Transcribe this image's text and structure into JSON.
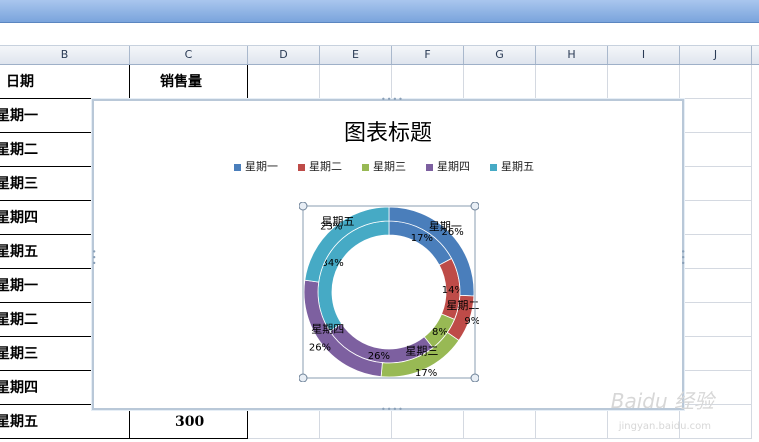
{
  "columns": [
    "B",
    "C",
    "D",
    "E",
    "F",
    "G",
    "H",
    "I",
    "J"
  ],
  "header_row": {
    "date_label": "日期",
    "sales_label": "销售量"
  },
  "rows": [
    {
      "day": "星期一"
    },
    {
      "day": "星期二"
    },
    {
      "day": "星期三"
    },
    {
      "day": "星期四"
    },
    {
      "day": "星期五"
    },
    {
      "day": "星期一"
    },
    {
      "day": "星期二"
    },
    {
      "day": "星期三"
    },
    {
      "day": "星期四"
    },
    {
      "day": "星期五",
      "sales": "300"
    }
  ],
  "chart": {
    "title": "图表标题"
  },
  "chart_data": {
    "type": "doughnut",
    "title": "图表标题",
    "categories": [
      "星期一",
      "星期二",
      "星期三",
      "星期四",
      "星期五"
    ],
    "colors": [
      "#4a7ebb",
      "#be4b48",
      "#98b954",
      "#7d60a0",
      "#46aac5"
    ],
    "series": [
      {
        "values": [
          17,
          14,
          8,
          26,
          34
        ]
      },
      {
        "values": [
          26,
          9,
          17,
          26,
          23
        ]
      }
    ],
    "legend": "top"
  },
  "watermark": {
    "text": "Baidu 经验",
    "sub": "jingyan.baidu.com"
  }
}
